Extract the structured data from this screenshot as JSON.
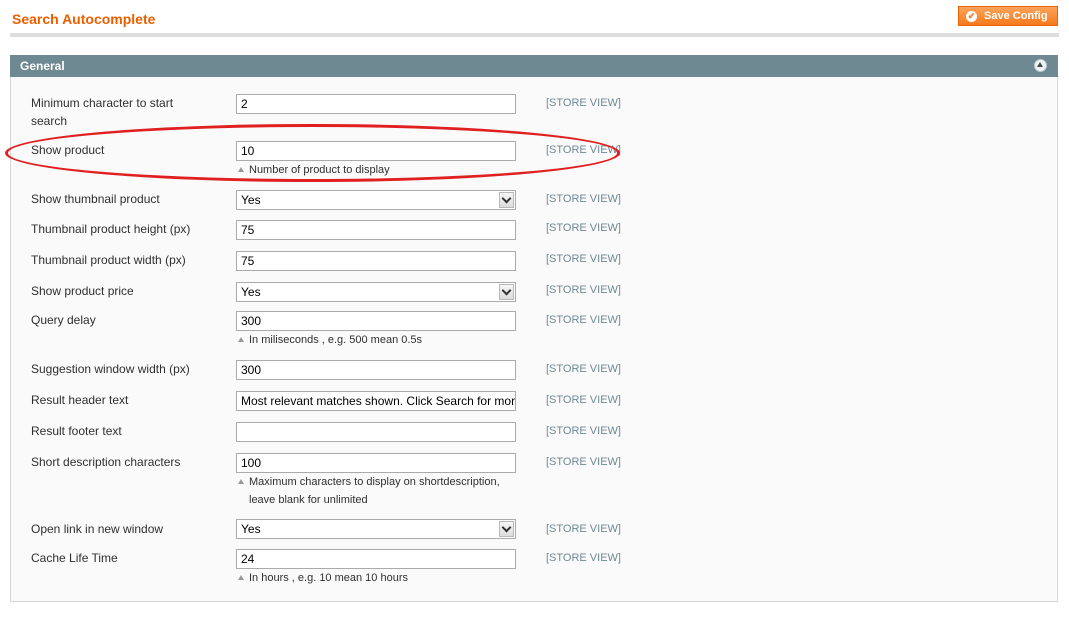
{
  "page": {
    "title": "Search Autocomplete",
    "save_label": "Save Config"
  },
  "section": {
    "title": "General"
  },
  "scope_label": "[STORE VIEW]",
  "fields": {
    "min_chars": {
      "label1": "Minimum character to start",
      "label2": "search",
      "value": "2"
    },
    "show_product": {
      "label": "Show product",
      "value": "10",
      "note": "Number of product to display"
    },
    "show_thumbnail": {
      "label": "Show thumbnail product",
      "value": "Yes"
    },
    "thumb_height": {
      "label": "Thumbnail product height (px)",
      "value": "75"
    },
    "thumb_width": {
      "label": "Thumbnail product width (px)",
      "value": "75"
    },
    "show_price": {
      "label": "Show product price",
      "value": "Yes"
    },
    "query_delay": {
      "label": "Query delay",
      "value": "300",
      "note": "In miliseconds , e.g. 500 mean 0.5s"
    },
    "window_width": {
      "label": "Suggestion window width (px)",
      "value": "300"
    },
    "header_text": {
      "label": "Result header text",
      "value": "Most relevant matches shown. Click Search for more items"
    },
    "footer_text": {
      "label": "Result footer text",
      "value": ""
    },
    "short_desc": {
      "label": "Short description characters",
      "value": "100",
      "note1": "Maximum characters to display on shortdescription,",
      "note2": "leave blank for unlimited"
    },
    "new_window": {
      "label": "Open link in new window",
      "value": "Yes"
    },
    "cache_life": {
      "label": "Cache Life Time",
      "value": "24",
      "note": "In hours , e.g. 10 mean 10 hours"
    }
  }
}
